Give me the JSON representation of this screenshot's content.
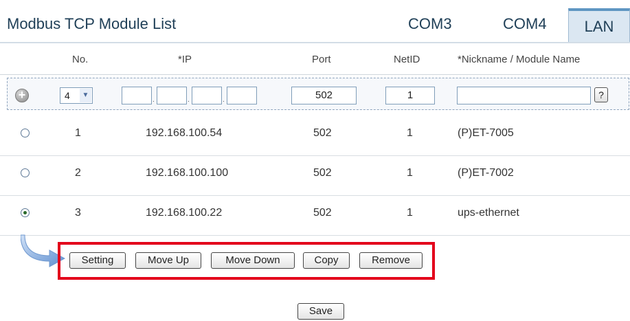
{
  "header": {
    "title": "Modbus TCP Module List",
    "tabs": [
      {
        "label": "COM3"
      },
      {
        "label": "COM4"
      },
      {
        "label": "LAN",
        "active": true
      }
    ]
  },
  "columns": {
    "no": "No.",
    "ip": "*IP",
    "port": "Port",
    "netid": "NetID",
    "nickname": "*Nickname / Module Name"
  },
  "add_row": {
    "no_value": "4",
    "ip_octets": [
      "",
      "",
      "",
      ""
    ],
    "port": "502",
    "netid": "1",
    "nickname": "",
    "help_label": "?"
  },
  "rows": [
    {
      "no": "1",
      "ip": "192.168.100.54",
      "port": "502",
      "netid": "1",
      "nickname": "(P)ET-7005",
      "selected": false
    },
    {
      "no": "2",
      "ip": "192.168.100.100",
      "port": "502",
      "netid": "1",
      "nickname": "(P)ET-7002",
      "selected": false
    },
    {
      "no": "3",
      "ip": "192.168.100.22",
      "port": "502",
      "netid": "1",
      "nickname": "ups-ethernet",
      "selected": true
    }
  ],
  "actions": {
    "setting": "Setting",
    "move_up": "Move Up",
    "move_down": "Move Down",
    "copy": "Copy",
    "remove": "Remove"
  },
  "save_label": "Save",
  "colors": {
    "highlight": "#e3001b",
    "title": "#1f3f57",
    "active_tab_bg": "#dbe7f2",
    "arrow": "#5f8fd0"
  }
}
